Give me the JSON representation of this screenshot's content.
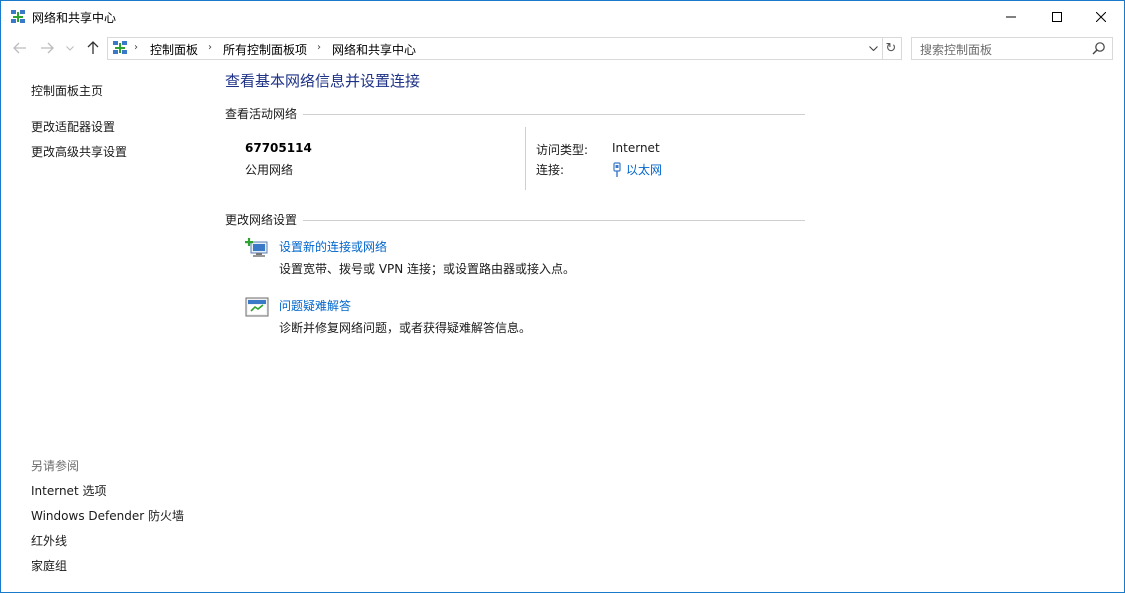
{
  "window": {
    "title": "网络和共享中心"
  },
  "nav": {
    "breadcrumbs": [
      "控制面板",
      "所有控制面板项",
      "网络和共享中心"
    ],
    "search_placeholder": "搜索控制面板"
  },
  "left_panel": {
    "links": [
      "控制面板主页",
      "更改适配器设置",
      "更改高级共享设置"
    ],
    "see_also_heading": "另请参阅",
    "see_also_links": [
      "Internet 选项",
      "Windows Defender 防火墙",
      "红外线",
      "家庭组"
    ]
  },
  "main": {
    "title": "查看基本网络信息并设置连接",
    "active_networks_heading": "查看活动网络",
    "network": {
      "name": "67705114",
      "type": "公用网络",
      "access_type_label": "访问类型:",
      "access_type_value": "Internet",
      "connections_label": "连接:",
      "connections_value": "以太网"
    },
    "change_settings_heading": "更改网络设置",
    "tasks": [
      {
        "title": "设置新的连接或网络",
        "description": "设置宽带、拨号或 VPN 连接；或设置路由器或接入点。",
        "icon": "new-connection-icon"
      },
      {
        "title": "问题疑难解答",
        "description": "诊断并修复网络问题，或者获得疑难解答信息。",
        "icon": "troubleshoot-icon"
      }
    ]
  },
  "colors": {
    "title_blue": "#1e3287",
    "link_blue": "#0066cc",
    "border_blue": "#1979ca"
  }
}
